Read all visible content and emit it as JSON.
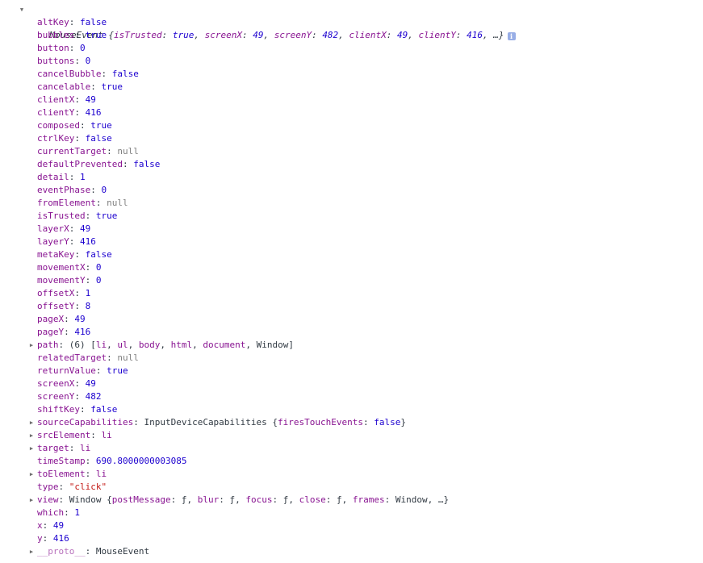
{
  "header": {
    "text_parts": [
      {
        "t": "MouseEvent {",
        "c": "obj"
      },
      {
        "t": "isTrusted",
        "c": "k"
      },
      {
        "t": ": ",
        "c": "obj"
      },
      {
        "t": "true",
        "c": "bool"
      },
      {
        "t": ", ",
        "c": "obj"
      },
      {
        "t": "screenX",
        "c": "k"
      },
      {
        "t": ": ",
        "c": "obj"
      },
      {
        "t": "49",
        "c": "num"
      },
      {
        "t": ", ",
        "c": "obj"
      },
      {
        "t": "screenY",
        "c": "k"
      },
      {
        "t": ": ",
        "c": "obj"
      },
      {
        "t": "482",
        "c": "num"
      },
      {
        "t": ", ",
        "c": "obj"
      },
      {
        "t": "clientX",
        "c": "k"
      },
      {
        "t": ": ",
        "c": "obj"
      },
      {
        "t": "49",
        "c": "num"
      },
      {
        "t": ", ",
        "c": "obj"
      },
      {
        "t": "clientY",
        "c": "k"
      },
      {
        "t": ": ",
        "c": "obj"
      },
      {
        "t": "416",
        "c": "num"
      },
      {
        "t": ", …}",
        "c": "obj"
      }
    ],
    "info_icon": "i"
  },
  "properties": [
    {
      "key": "altKey",
      "value": "false",
      "type": "bool"
    },
    {
      "key": "bubbles",
      "value": "true",
      "type": "bool"
    },
    {
      "key": "button",
      "value": "0",
      "type": "num"
    },
    {
      "key": "buttons",
      "value": "0",
      "type": "num"
    },
    {
      "key": "cancelBubble",
      "value": "false",
      "type": "bool"
    },
    {
      "key": "cancelable",
      "value": "true",
      "type": "bool"
    },
    {
      "key": "clientX",
      "value": "49",
      "type": "num"
    },
    {
      "key": "clientY",
      "value": "416",
      "type": "num"
    },
    {
      "key": "composed",
      "value": "true",
      "type": "bool"
    },
    {
      "key": "ctrlKey",
      "value": "false",
      "type": "bool"
    },
    {
      "key": "currentTarget",
      "value": "null",
      "type": "null"
    },
    {
      "key": "defaultPrevented",
      "value": "false",
      "type": "bool"
    },
    {
      "key": "detail",
      "value": "1",
      "type": "num"
    },
    {
      "key": "eventPhase",
      "value": "0",
      "type": "num"
    },
    {
      "key": "fromElement",
      "value": "null",
      "type": "null"
    },
    {
      "key": "isTrusted",
      "value": "true",
      "type": "bool"
    },
    {
      "key": "layerX",
      "value": "49",
      "type": "num"
    },
    {
      "key": "layerY",
      "value": "416",
      "type": "num"
    },
    {
      "key": "metaKey",
      "value": "false",
      "type": "bool"
    },
    {
      "key": "movementX",
      "value": "0",
      "type": "num"
    },
    {
      "key": "movementY",
      "value": "0",
      "type": "num"
    },
    {
      "key": "offsetX",
      "value": "1",
      "type": "num"
    },
    {
      "key": "offsetY",
      "value": "8",
      "type": "num"
    },
    {
      "key": "pageX",
      "value": "49",
      "type": "num"
    },
    {
      "key": "pageY",
      "value": "416",
      "type": "num"
    },
    {
      "key": "path",
      "expandable": true,
      "parts": [
        {
          "t": "(6) [",
          "c": "obj"
        },
        {
          "t": "li",
          "c": "k"
        },
        {
          "t": ", ",
          "c": "obj"
        },
        {
          "t": "ul",
          "c": "k"
        },
        {
          "t": ", ",
          "c": "obj"
        },
        {
          "t": "body",
          "c": "k"
        },
        {
          "t": ", ",
          "c": "obj"
        },
        {
          "t": "html",
          "c": "k"
        },
        {
          "t": ", ",
          "c": "obj"
        },
        {
          "t": "document",
          "c": "k"
        },
        {
          "t": ", Window]",
          "c": "obj"
        }
      ]
    },
    {
      "key": "relatedTarget",
      "value": "null",
      "type": "null"
    },
    {
      "key": "returnValue",
      "value": "true",
      "type": "bool"
    },
    {
      "key": "screenX",
      "value": "49",
      "type": "num"
    },
    {
      "key": "screenY",
      "value": "482",
      "type": "num"
    },
    {
      "key": "shiftKey",
      "value": "false",
      "type": "bool"
    },
    {
      "key": "sourceCapabilities",
      "expandable": true,
      "parts": [
        {
          "t": "InputDeviceCapabilities {",
          "c": "obj"
        },
        {
          "t": "firesTouchEvents",
          "c": "k"
        },
        {
          "t": ": ",
          "c": "obj"
        },
        {
          "t": "false",
          "c": "bool"
        },
        {
          "t": "}",
          "c": "obj"
        }
      ]
    },
    {
      "key": "srcElement",
      "expandable": true,
      "parts": [
        {
          "t": "li",
          "c": "k"
        }
      ]
    },
    {
      "key": "target",
      "expandable": true,
      "parts": [
        {
          "t": "li",
          "c": "k"
        }
      ]
    },
    {
      "key": "timeStamp",
      "value": "690.8000000003085",
      "type": "num"
    },
    {
      "key": "toElement",
      "expandable": true,
      "parts": [
        {
          "t": "li",
          "c": "k"
        }
      ]
    },
    {
      "key": "type",
      "value": "\"click\"",
      "type": "str"
    },
    {
      "key": "view",
      "expandable": true,
      "parts": [
        {
          "t": "Window {",
          "c": "obj"
        },
        {
          "t": "postMessage",
          "c": "k"
        },
        {
          "t": ": ",
          "c": "obj"
        },
        {
          "t": "ƒ",
          "c": "obj"
        },
        {
          "t": ", ",
          "c": "obj"
        },
        {
          "t": "blur",
          "c": "k"
        },
        {
          "t": ": ",
          "c": "obj"
        },
        {
          "t": "ƒ",
          "c": "obj"
        },
        {
          "t": ", ",
          "c": "obj"
        },
        {
          "t": "focus",
          "c": "k"
        },
        {
          "t": ": ",
          "c": "obj"
        },
        {
          "t": "ƒ",
          "c": "obj"
        },
        {
          "t": ", ",
          "c": "obj"
        },
        {
          "t": "close",
          "c": "k"
        },
        {
          "t": ": ",
          "c": "obj"
        },
        {
          "t": "ƒ",
          "c": "obj"
        },
        {
          "t": ", ",
          "c": "obj"
        },
        {
          "t": "frames",
          "c": "k"
        },
        {
          "t": ": Window, …}",
          "c": "obj"
        }
      ]
    },
    {
      "key": "which",
      "value": "1",
      "type": "num"
    },
    {
      "key": "x",
      "value": "49",
      "type": "num"
    },
    {
      "key": "y",
      "value": "416",
      "type": "num"
    },
    {
      "key": "__proto__",
      "expandable": true,
      "proto": true,
      "parts": [
        {
          "t": "MouseEvent",
          "c": "obj"
        }
      ]
    }
  ],
  "colors": {
    "key": "#881391",
    "number_bool": "#1c00cf",
    "string": "#c41a16",
    "null": "#808080",
    "text": "#303942"
  }
}
